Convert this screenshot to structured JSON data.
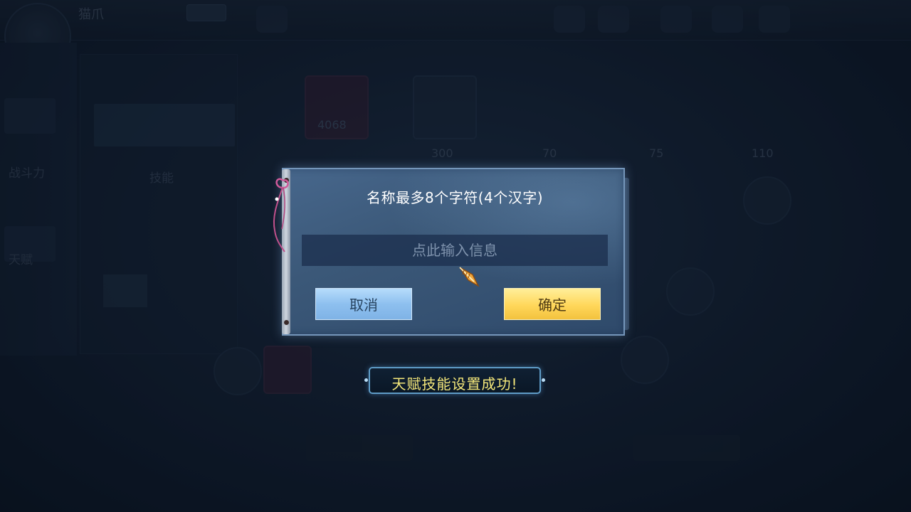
{
  "background": {
    "player_name": "猫爪",
    "left_texts": [
      "战斗力",
      "天赋",
      "技能"
    ],
    "slot_values": [
      "4068",
      "300",
      "70",
      "75",
      "110"
    ]
  },
  "dialog": {
    "title": "名称最多8个字符(4个汉字)",
    "input_placeholder": "点此输入信息",
    "input_value": "",
    "cancel_label": "取消",
    "confirm_label": "确定"
  },
  "toast": {
    "message": "天赋技能设置成功!"
  },
  "colors": {
    "dialog_bg": "#3b5878",
    "cancel_button": "#8ec0ef",
    "confirm_button": "#ffd75a",
    "toast_text": "#f4e77a"
  },
  "icons": {
    "cursor": "feather-pen-cursor-icon",
    "ribbon": "ribbon-icon"
  }
}
